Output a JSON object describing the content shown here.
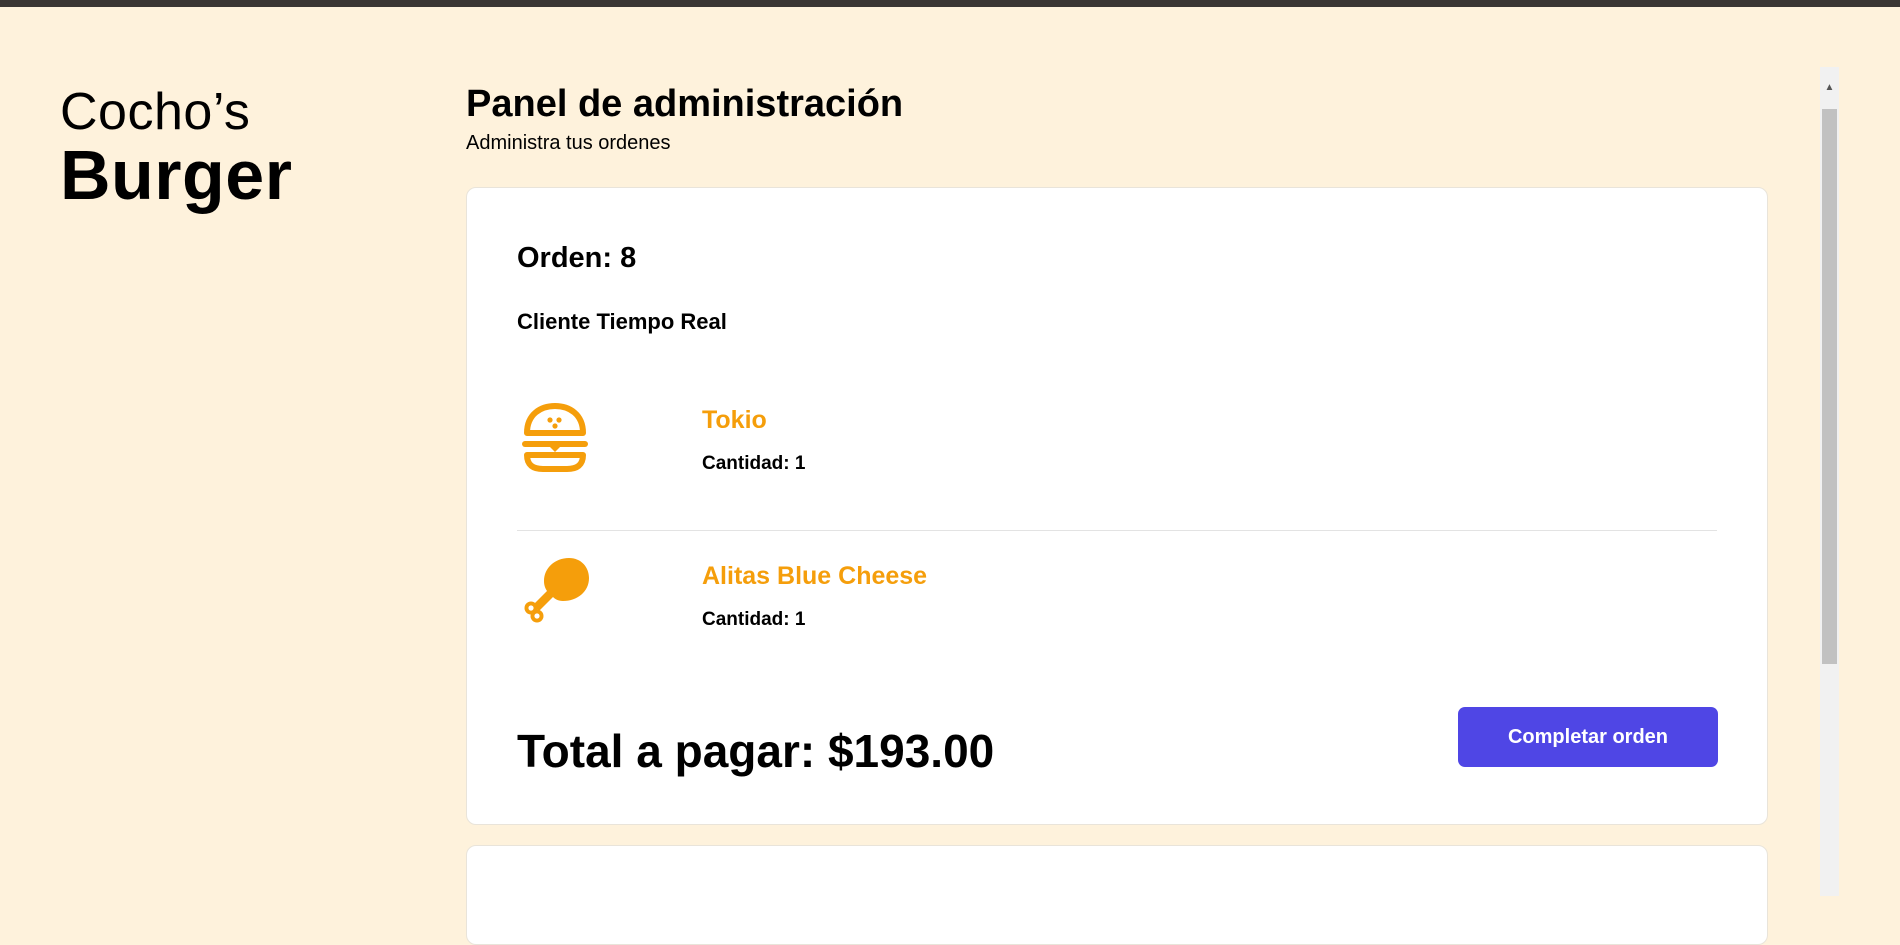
{
  "logo": {
    "line1": "Cocho’s",
    "line2": "Burger"
  },
  "header": {
    "title": "Panel de administración",
    "subtitle": "Administra tus ordenes"
  },
  "order": {
    "title": "Orden: 8",
    "client": "Cliente Tiempo Real",
    "items": [
      {
        "name": "Tokio",
        "quantity": "Cantidad: 1",
        "icon": "burger-icon"
      },
      {
        "name": "Alitas Blue Cheese",
        "quantity": "Cantidad: 1",
        "icon": "chicken-leg-icon"
      }
    ],
    "total": "Total a pagar: $193.00",
    "complete_label": "Completar orden"
  },
  "colors": {
    "background": "#fef2dc",
    "accent_orange": "#f59e0b",
    "button": "#4f46e5"
  }
}
